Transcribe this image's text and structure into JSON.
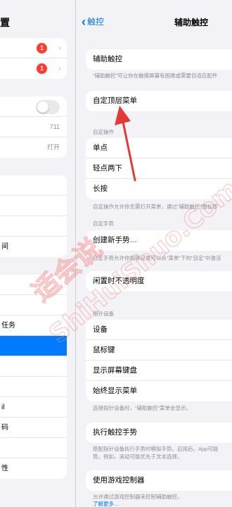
{
  "left_pane": {
    "title": "置",
    "group1": [
      {
        "label": "",
        "badge": "1"
      },
      {
        "label": "",
        "badge": "1"
      }
    ],
    "group2": [
      {
        "label": "",
        "control": "toggle"
      },
      {
        "label": "",
        "value": "711"
      },
      {
        "label": "",
        "value": "打开"
      }
    ],
    "group3": [
      {
        "label": ""
      },
      {
        "label": ""
      },
      {
        "label": ""
      },
      {
        "label": "间"
      }
    ],
    "group4": [
      {
        "label": ""
      },
      {
        "label": ""
      },
      {
        "label": "任务"
      },
      {
        "label": ""
      },
      {
        "label": ""
      },
      {
        "label": ""
      },
      {
        "label": "il"
      },
      {
        "label": "码"
      },
      {
        "label": ""
      },
      {
        "label": "性"
      }
    ]
  },
  "nav": {
    "back_label": "触控",
    "title": "辅助触控"
  },
  "main": {
    "assistive_touch": {
      "label": "辅助触控",
      "footnote": "“辅助触控”可让你在触摸屏幕有困难或需要自适应配件"
    },
    "customize_top_menu": {
      "label": "自定顶层菜单"
    },
    "custom_actions": {
      "header": "自定操作",
      "items": [
        "单点",
        "轻点两下",
        "长按"
      ],
      "footnote": "自定操作允许你无需打开菜单，通过“辅助触控”图标即"
    },
    "custom_gestures": {
      "header": "自定手势",
      "label": "创建新手势…",
      "footnote": "自定手势允许你能够记录可以从“菜单”下的“自定”中激活"
    },
    "idle_opacity": {
      "label": "闲置时不透明度"
    },
    "pointer_devices": {
      "header": "指针设备",
      "items": [
        "设备",
        "鼠标键",
        "显示屏幕键盘",
        "始终显示菜单"
      ],
      "footnote": "连接指针设备时，“辅助触控”菜单会显示。"
    },
    "perform_gestures": {
      "label": "执行触控手势",
      "footnote1": "搭配指针设备执行手势时模拟手势。启用后，App可能",
      "footnote2": "势。例如，滚动可能优先于文本选择。"
    },
    "game_controller": {
      "label": "使用游戏控制器",
      "footnote": "允许通过游戏控制器来控制辅助触控。",
      "more": "了解更多…"
    }
  },
  "watermark": {
    "text_cn": "适会说",
    "text_en": "ShiHuiShuo.Com"
  },
  "colors": {
    "accent": "#007aff",
    "badge": "#ff3b30",
    "arrow": "#e53935",
    "watermark": "#f28b8b"
  }
}
